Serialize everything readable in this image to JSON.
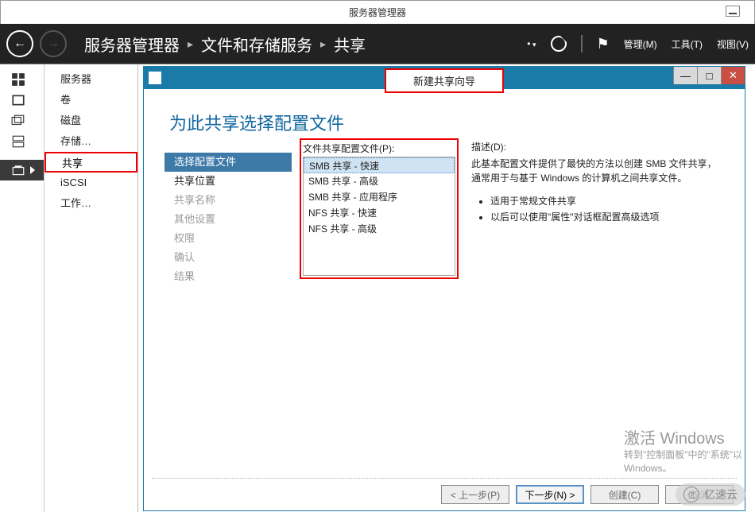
{
  "outer_window": {
    "title": "服务器管理器"
  },
  "nav": {
    "breadcrumb": [
      "服务器管理器",
      "文件和存储服务",
      "共享"
    ],
    "menu": {
      "manage": "管理(M)",
      "tools": "工具(T)",
      "view": "视图(V)"
    }
  },
  "sidebar": {
    "icons": [
      "dashboard-icon",
      "server-icon",
      "server-group-icon",
      "disk-icon",
      "storage-icon"
    ],
    "items": [
      {
        "label": "服务器",
        "selected": false
      },
      {
        "label": "卷",
        "selected": false
      },
      {
        "label": "磁盘",
        "selected": false
      },
      {
        "label": "存储…",
        "selected": false
      },
      {
        "label": "共享",
        "selected": true
      },
      {
        "label": "iSCSI",
        "selected": false
      },
      {
        "label": "工作…",
        "selected": false
      }
    ]
  },
  "wizard": {
    "title": "新建共享向导",
    "heading": "为此共享选择配置文件",
    "steps": [
      {
        "label": "选择配置文件",
        "state": "active"
      },
      {
        "label": "共享位置",
        "state": "avail"
      },
      {
        "label": "共享名称",
        "state": "disabled"
      },
      {
        "label": "其他设置",
        "state": "disabled"
      },
      {
        "label": "权限",
        "state": "disabled"
      },
      {
        "label": "确认",
        "state": "disabled"
      },
      {
        "label": "结果",
        "state": "disabled"
      }
    ],
    "profile_list": {
      "label": "文件共享配置文件(P):",
      "options": [
        {
          "label": "SMB 共享 - 快速",
          "selected": true
        },
        {
          "label": "SMB 共享 - 高级",
          "selected": false
        },
        {
          "label": "SMB 共享 - 应用程序",
          "selected": false
        },
        {
          "label": "NFS 共享 - 快速",
          "selected": false
        },
        {
          "label": "NFS 共享 - 高级",
          "selected": false
        }
      ]
    },
    "description": {
      "label": "描述(D):",
      "text": "此基本配置文件提供了最快的方法以创建 SMB 文件共享，通常用于与基于 Windows 的计算机之间共享文件。",
      "bullets": [
        "适用于常规文件共享",
        "以后可以使用\"属性\"对话框配置高级选项"
      ]
    },
    "buttons": {
      "prev": "< 上一步(P)",
      "next": "下一步(N) >",
      "create": "创建(C)",
      "cancel": "取消"
    }
  },
  "watermark": {
    "line1": "激活 Windows",
    "line2": "转到\"控制面板\"中的\"系统\"以",
    "line3": "Windows。"
  },
  "brand": "亿速云"
}
